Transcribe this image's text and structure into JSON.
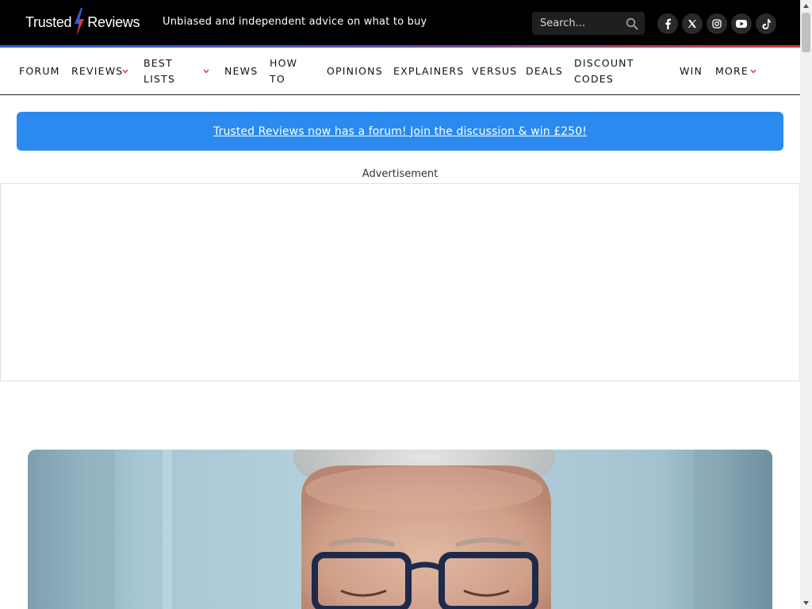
{
  "header": {
    "logo_left": "Trusted",
    "logo_right": "Reviews",
    "tagline": "Unbiased and independent advice on what to buy",
    "search_placeholder": "Search...",
    "social": [
      "facebook-icon",
      "x-icon",
      "instagram-icon",
      "youtube-icon",
      "tiktok-icon"
    ]
  },
  "nav": {
    "forum": "FORUM",
    "reviews": "REVIEWS",
    "best_lists_1": "BEST",
    "best_lists_2": "LISTS",
    "news": "NEWS",
    "how_to_1": "HOW",
    "how_to_2": "TO",
    "opinions": "OPINIONS",
    "explainers": "EXPLAINERS",
    "versus": "VERSUS",
    "deals": "DEALS",
    "discount_codes_1": "DISCOUNT",
    "discount_codes_2": "CODES",
    "win": "WIN",
    "more": "MORE"
  },
  "banner": {
    "text": "Trusted Reviews now has a forum! Join the discussion & win £250!"
  },
  "ad": {
    "label": "Advertisement"
  },
  "colors": {
    "header_bg": "#000000",
    "banner_bg": "#2a8af0",
    "accent_red": "#d83a3a",
    "accent_blue": "#2b5fd9"
  }
}
